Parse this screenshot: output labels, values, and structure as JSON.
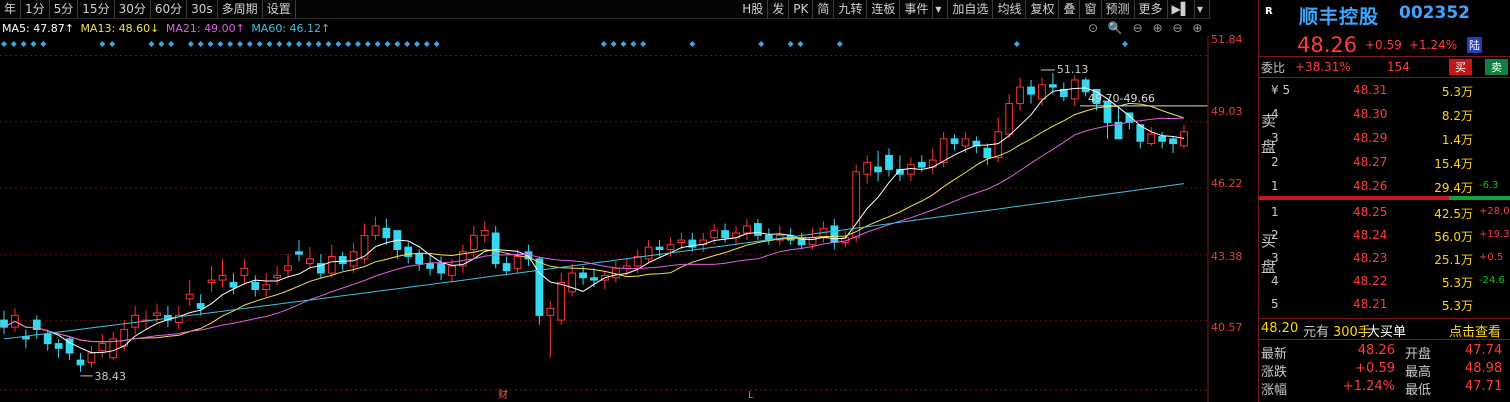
{
  "toolbar": {
    "left": [
      "年",
      "1分",
      "5分",
      "15分",
      "30分",
      "60分",
      "30s",
      "多周期",
      "设置"
    ],
    "right": [
      "H股",
      "发",
      "PK",
      "简",
      "九转",
      "连板",
      "事件",
      "加自选",
      "均线",
      "复权",
      "叠",
      "窗",
      "预测",
      "更多"
    ]
  },
  "ma_legend": [
    {
      "label": "MA5: 47.87↑",
      "color": "#ffffff"
    },
    {
      "label": "MA13: 48.60↓",
      "color": "#f2e24a"
    },
    {
      "label": "MA21: 49.00↑",
      "color": "#e060e0"
    },
    {
      "label": "MA60: 46.12↑",
      "color": "#3fc1e0"
    }
  ],
  "chart_tools": [
    "⊙",
    "🔍",
    "⊖",
    "⊕",
    "⊖",
    "⊕"
  ],
  "chart": {
    "price_axis": [
      "51.84",
      "49.03",
      "46.22",
      "43.38",
      "40.57"
    ],
    "high_label": "51.13",
    "low_label": "38.43",
    "range_label": "49.70-49.66",
    "markers": [
      "财",
      "L"
    ]
  },
  "chart_data": {
    "type": "candlestick",
    "ylim": [
      37.8,
      52.5
    ],
    "open": [
      40.6,
      40.3,
      39.9,
      40.6,
      40.0,
      39.6,
      39.8,
      38.9,
      38.8,
      39.3,
      39.0,
      39.5,
      40.3,
      40.6,
      40.8,
      40.8,
      40.5,
      41.5,
      41.3,
      42.2,
      42.3,
      42.2,
      42.5,
      42.2,
      41.9,
      42.4,
      42.7,
      43.5,
      43.0,
      43.0,
      42.6,
      43.3,
      42.9,
      43.2,
      44.2,
      44.5,
      44.4,
      43.7,
      43.4,
      43.0,
      43.0,
      42.5,
      42.9,
      43.6,
      44.2,
      44.3,
      43.0,
      42.8,
      43.5,
      43.2,
      40.8,
      40.6,
      41.8,
      42.6,
      42.4,
      42.3,
      42.4,
      42.8,
      42.9,
      43.2,
      43.7,
      43.6,
      43.9,
      44.0,
      43.8,
      44.1,
      44.4,
      44.1,
      44.3,
      44.7,
      44.2,
      44.0,
      44.2,
      44.1,
      43.8,
      44.1,
      44.6,
      43.9,
      44.1,
      46.8,
      47.1,
      47.6,
      47.0,
      46.8,
      47.3,
      47.1,
      47.3,
      48.3,
      48.0,
      48.2,
      47.9,
      47.5,
      48.5,
      49.8,
      50.5,
      50.0,
      50.6,
      50.4,
      50.0,
      50.8,
      50.4,
      49.9,
      49.0,
      49.4,
      48.9,
      48.1,
      48.4,
      48.3,
      48.0
    ],
    "close": [
      40.3,
      40.8,
      39.8,
      40.2,
      39.6,
      39.4,
      39.2,
      38.7,
      39.2,
      39.6,
      39.8,
      40.2,
      40.8,
      40.6,
      40.9,
      40.6,
      40.8,
      41.7,
      41.1,
      42.3,
      42.5,
      42.0,
      42.8,
      41.9,
      42.1,
      42.5,
      42.9,
      43.4,
      43.2,
      42.6,
      43.3,
      43.0,
      43.5,
      44.2,
      44.6,
      44.1,
      43.6,
      43.3,
      43.0,
      42.8,
      42.6,
      42.9,
      43.5,
      44.2,
      44.4,
      43.0,
      42.7,
      43.3,
      43.2,
      40.8,
      41.1,
      42.2,
      42.6,
      42.4,
      42.3,
      42.5,
      42.8,
      42.9,
      43.3,
      43.7,
      43.6,
      43.8,
      44.0,
      43.7,
      44.0,
      44.4,
      44.1,
      44.3,
      44.6,
      44.2,
      44.0,
      44.2,
      44.0,
      43.8,
      44.1,
      44.5,
      43.9,
      44.1,
      46.9,
      47.3,
      46.9,
      47.0,
      46.8,
      47.2,
      47.1,
      47.4,
      48.3,
      48.1,
      48.3,
      48.0,
      47.5,
      48.6,
      49.8,
      50.5,
      50.2,
      50.6,
      50.5,
      50.1,
      50.8,
      50.3,
      49.8,
      49.0,
      48.3,
      49.0,
      48.2,
      48.5,
      48.2,
      48.1,
      48.6
    ],
    "high": [
      41.0,
      41.1,
      40.2,
      40.8,
      40.2,
      39.8,
      39.9,
      39.2,
      39.5,
      40.0,
      40.1,
      40.6,
      41.2,
      41.0,
      41.3,
      41.2,
      41.2,
      42.3,
      41.7,
      42.9,
      43.2,
      42.6,
      43.2,
      42.5,
      42.6,
      42.9,
      43.4,
      44.0,
      43.7,
      43.4,
      43.8,
      43.5,
      43.9,
      44.7,
      45.0,
      44.9,
      44.1,
      43.9,
      43.6,
      43.4,
      43.3,
      43.2,
      43.8,
      44.6,
      44.8,
      44.6,
      43.3,
      43.6,
      43.8,
      43.3,
      41.4,
      42.6,
      43.0,
      42.9,
      42.8,
      42.7,
      43.1,
      43.2,
      43.6,
      44.0,
      44.0,
      44.1,
      44.3,
      44.3,
      44.3,
      44.7,
      44.7,
      44.6,
      44.9,
      44.9,
      44.5,
      44.6,
      44.5,
      44.3,
      44.5,
      44.8,
      44.9,
      44.4,
      47.2,
      47.6,
      47.8,
      47.9,
      47.6,
      47.5,
      47.6,
      47.9,
      48.6,
      48.5,
      48.6,
      48.4,
      48.1,
      49.2,
      50.2,
      50.9,
      50.8,
      50.9,
      51.1,
      50.7,
      51.0,
      50.9,
      50.2,
      49.5,
      49.6,
      49.3,
      48.9,
      48.8,
      48.6,
      48.4,
      48.9
    ],
    "low": [
      40.0,
      40.1,
      39.4,
      39.8,
      39.3,
      39.0,
      38.9,
      38.4,
      38.6,
      39.0,
      38.9,
      39.3,
      40.0,
      40.2,
      40.5,
      40.3,
      40.2,
      41.2,
      40.8,
      41.8,
      42.0,
      41.7,
      42.1,
      41.6,
      41.6,
      42.1,
      42.4,
      43.1,
      42.8,
      42.4,
      42.4,
      42.7,
      42.6,
      43.0,
      44.0,
      43.8,
      43.2,
      43.0,
      42.7,
      42.5,
      42.3,
      42.2,
      42.6,
      43.2,
      43.9,
      42.8,
      42.5,
      42.6,
      42.9,
      40.4,
      39.0,
      40.4,
      41.6,
      42.1,
      42.0,
      41.9,
      42.2,
      42.5,
      42.6,
      43.0,
      43.3,
      43.3,
      43.6,
      43.5,
      43.5,
      43.8,
      43.9,
      43.8,
      44.0,
      44.0,
      43.8,
      43.8,
      43.8,
      43.6,
      43.6,
      43.9,
      43.6,
      43.7,
      43.9,
      46.4,
      46.5,
      46.7,
      46.5,
      46.5,
      46.9,
      46.8,
      47.1,
      47.8,
      47.7,
      47.7,
      47.2,
      47.3,
      48.3,
      49.5,
      49.8,
      49.7,
      50.2,
      49.9,
      49.7,
      50.1,
      49.5,
      48.3,
      48.6,
      48.7,
      47.9,
      48.0,
      47.9,
      47.7,
      47.9
    ],
    "ma_series": [
      {
        "name": "MA5",
        "color": "#ffffff"
      },
      {
        "name": "MA13",
        "color": "#f2e24a"
      },
      {
        "name": "MA21",
        "color": "#e060e0"
      },
      {
        "name": "MA60",
        "color": "#3fc1e0"
      }
    ]
  },
  "quote": {
    "badge": "R",
    "name": "顺丰控股",
    "code": "002352",
    "price": "48.26",
    "change": "+0.59",
    "change_pct": "+1.24%",
    "market_tag": "陆",
    "weibi_label": "委比",
    "weibi_value": "+38.31%",
    "weicha": "154",
    "buy_btn": "买",
    "sell_btn": "卖",
    "sell_side_label": [
      "卖",
      "盘"
    ],
    "buy_side_label": [
      "买",
      "盘"
    ],
    "asks": [
      {
        "lv": "¥ 5",
        "price": "48.31",
        "vol": "5.3万",
        "delta": ""
      },
      {
        "lv": "4",
        "price": "48.30",
        "vol": "8.2万",
        "delta": ""
      },
      {
        "lv": "3",
        "price": "48.29",
        "vol": "1.4万",
        "delta": ""
      },
      {
        "lv": "2",
        "price": "48.27",
        "vol": "15.4万",
        "delta": ""
      },
      {
        "lv": "1",
        "price": "48.26",
        "vol": "29.4万",
        "delta": "-6.3"
      }
    ],
    "bids": [
      {
        "lv": "1",
        "price": "48.25",
        "vol": "42.5万",
        "delta": "+28.0"
      },
      {
        "lv": "2",
        "price": "48.24",
        "vol": "56.0万",
        "delta": "+19.3"
      },
      {
        "lv": "3",
        "price": "48.23",
        "vol": "25.1万",
        "delta": "+0.5"
      },
      {
        "lv": "4",
        "price": "48.22",
        "vol": "5.3万",
        "delta": "-24.6"
      },
      {
        "lv": "5",
        "price": "48.21",
        "vol": "5.3万",
        "delta": ""
      }
    ],
    "big_order": {
      "price": "48.20",
      "unit": "元有",
      "hands": "300手",
      "text": "大买单",
      "action": "点击查看"
    },
    "stats": [
      {
        "k1": "最新",
        "v1": "48.26",
        "k2": "开盘",
        "v2": "47.74"
      },
      {
        "k1": "涨跌",
        "v1": "+0.59",
        "k2": "最高",
        "v2": "48.98"
      },
      {
        "k1": "涨幅",
        "v1": "+1.24%",
        "k2": "最低",
        "v2": "47.71"
      }
    ]
  }
}
